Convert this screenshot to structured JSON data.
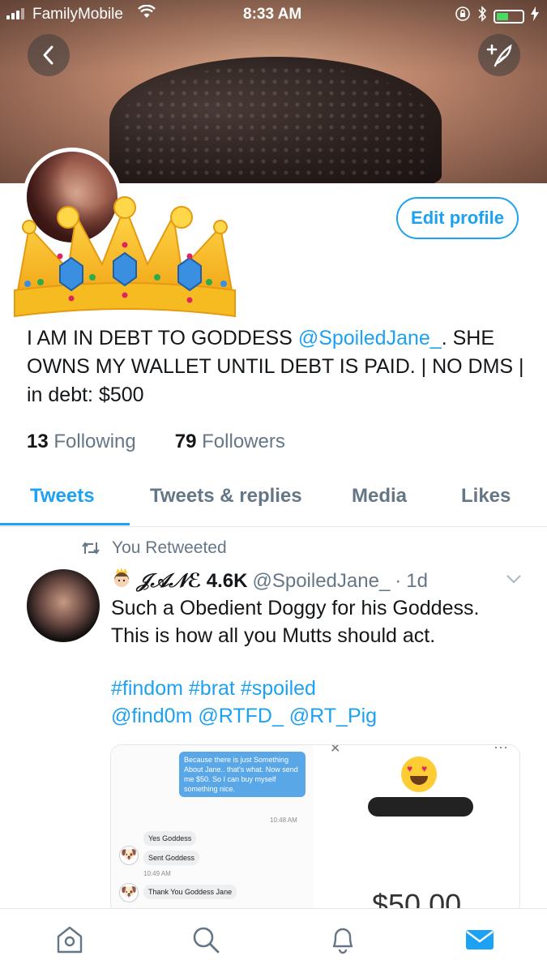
{
  "status_bar": {
    "carrier": "FamilyMobile",
    "time": "8:33 AM"
  },
  "header": {
    "back_icon": "chevron-left-icon",
    "compose_icon": "feather-plus-icon"
  },
  "profile": {
    "edit_label": "Edit profile",
    "bio_before": "I AM IN DEBT TO GODDESS ",
    "bio_mention": "@SpoiledJane_",
    "bio_after": ". SHE OWNS MY WALLET UNTIL DEBT IS PAID. | NO DMS | in debt: $500",
    "following_count": "13",
    "following_label": "Following",
    "followers_count": "79",
    "followers_label": "Followers"
  },
  "tabs": [
    {
      "label": "Tweets",
      "active": true
    },
    {
      "label": "Tweets & replies",
      "active": false
    },
    {
      "label": "Media",
      "active": false
    },
    {
      "label": "Likes",
      "active": false
    }
  ],
  "tweet": {
    "retweet_label": "You Retweeted",
    "display_name": "𝒥𝒜𝒩ℰ",
    "name_suffix": "4.6K",
    "handle": "@SpoiledJane_",
    "separator": "·",
    "age": "1d",
    "text_line1": "Such a Obedient Doggy for his Goddess.",
    "text_line2": "This is how all you Mutts should act.",
    "tags_line1": "#findom #brat #spoiled",
    "tags_line2": "@find0m @RTFD_ @RT_Pig",
    "media": {
      "bubble_text": "Because there is just Something About Jane.. that's what. Now send me $50. So I can buy myself something nice.",
      "bubble_time": "10:48 AM",
      "reply1": "Yes Goddess",
      "reply2": "Sent Goddess",
      "reply2_time": "10:49 AM",
      "reply3": "Thank You Goddess Jane",
      "amount": "$50.00"
    }
  },
  "bottom_nav": [
    "home-icon",
    "search-icon",
    "notifications-icon",
    "messages-icon"
  ],
  "colors": {
    "accent": "#1da1f2",
    "muted": "#657786",
    "text": "#14171a"
  }
}
